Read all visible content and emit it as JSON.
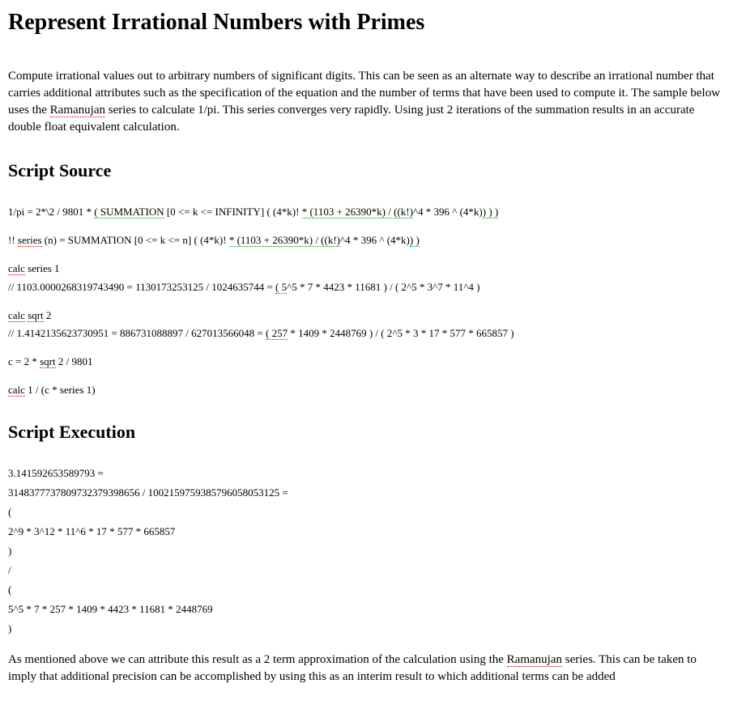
{
  "title": "Represent Irrational Numbers with Primes",
  "intro": {
    "part1": "Compute irrational values out to arbitrary numbers of significant digits.  This can be seen as an alternate way to describe an irrational number that carries additional attributes such as the specification of the equation and the number of terms that have been used to compute it.  The sample below uses the ",
    "link": "Ramanujan",
    "part2": " series to calculate 1/pi.  This series converges very rapidly.  Using just 2 iterations of the summation results in an accurate double float equivalent calculation."
  },
  "heading_source": "Script Source",
  "source": {
    "line1": {
      "a": "1/pi = 2*\\2 / 9801 * ",
      "b": "( SUMMATION",
      "c": " [0 <= k <= INFINITY] ( (4*k)! ",
      "d": "* (1103 + 26390*k) / ((k!)",
      "e": "^4 * 396 ^ (4*k)",
      "f": ") ) )"
    },
    "line2": {
      "a": "!! ",
      "b": "series",
      "c": " (n) = SUMMATION [0 <= k <= n] ( (4*k)! ",
      "d": "* (1103 + 26390*k) / ((k!)",
      "e": "^4 * 396 ^ (4*k)",
      "f": ") )"
    },
    "line3": {
      "a": "calc",
      "b": " series 1"
    },
    "line3b": {
      "a": "// 1103.0000268319743490 = 1130173253125 / 1024635744 = ",
      "b": "( 5",
      "c": "^5 * 7 * 4423 * 11681 ) / ( 2^5 * 3^7 * 11^4 )"
    },
    "line4": {
      "a": "calc",
      "b": " ",
      "c": "sqrt",
      "d": " 2"
    },
    "line4b": {
      "a": "// 1.4142135623730951 = 886731088897 / 627013566048 = ",
      "b": "( 257",
      "c": " * 1409 * 2448769 ) / ( 2^5 * 3 * 17 * 577 * 665857 )"
    },
    "line5": {
      "a": "c = 2 * ",
      "b": "sqrt",
      "c": " 2 / 9801"
    },
    "line6": {
      "a": "calc",
      "b": " 1 / (c * series 1)"
    }
  },
  "heading_exec": "Script Execution",
  "exec": {
    "result": "3.141592653589793 =",
    "frac": "314837773780973237939865​6 / 1002159759385796058053125 =",
    "open1": "(",
    "num": "2^9 * 3^12 * 11^6 * 17 * 577 * 665857",
    "close1": ")",
    "slash": "/",
    "open2": "(",
    "den": "5^5 * 7 * 257 * 1409 * 4423 * 11681 * 2448769",
    "close2": ")"
  },
  "closing": {
    "part1": "As mentioned above we can attribute this result as a 2 term approximation of the calculation using the ",
    "link": "Ramanujan",
    "part2": " series.  This can be taken to imply that additional precision can be accomplished by using this as an interim result to which additional terms can be added"
  }
}
